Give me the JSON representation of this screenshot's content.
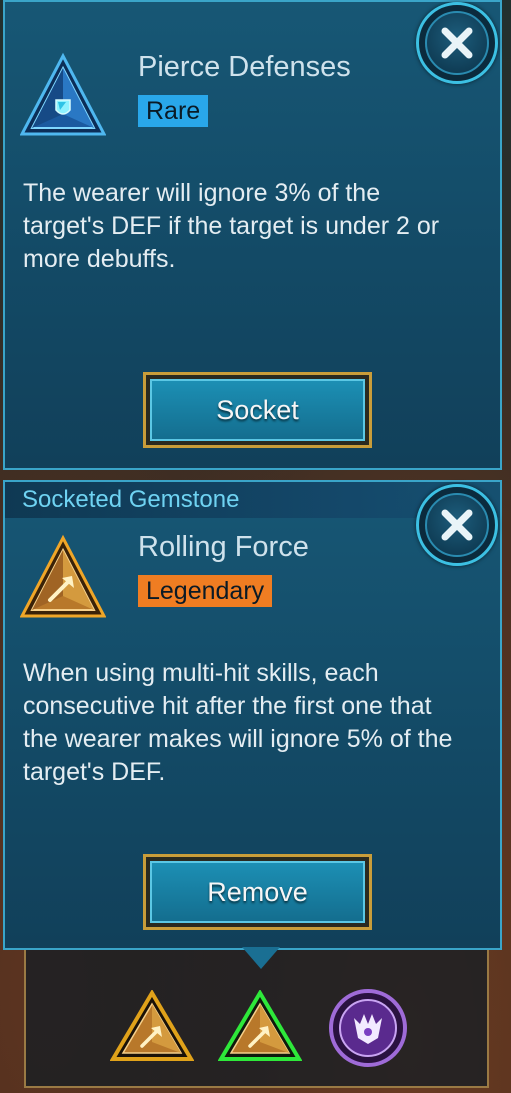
{
  "top_gem": {
    "name": "Pierce Defenses",
    "rarity": "Rare",
    "description": "The wearer will ignore 3% of the target's DEF if the target is under 2 or more debuffs.",
    "button_label": "Socket",
    "icon": "blue-triangle-shield-gem-icon"
  },
  "socketed": {
    "section_title": "Socketed Gemstone",
    "name": "Rolling Force",
    "rarity": "Legendary",
    "description": "When using multi-hit skills, each consecutive hit after the first one that the wearer makes will ignore 5% of the target's DEF.",
    "button_label": "Remove",
    "icon": "gold-triangle-arrow-gem-icon"
  },
  "slots": [
    {
      "icon": "gold-triangle-gem-icon",
      "border": "#e0a21a"
    },
    {
      "icon": "gold-triangle-gem-icon",
      "border": "#2ee83a"
    },
    {
      "icon": "purple-round-gem-icon",
      "border": "#9f6bd8"
    }
  ],
  "colors": {
    "rare": "#29a7ea",
    "legendary": "#ef7d22",
    "panel": "#175775",
    "accent": "#3aa5c9"
  }
}
